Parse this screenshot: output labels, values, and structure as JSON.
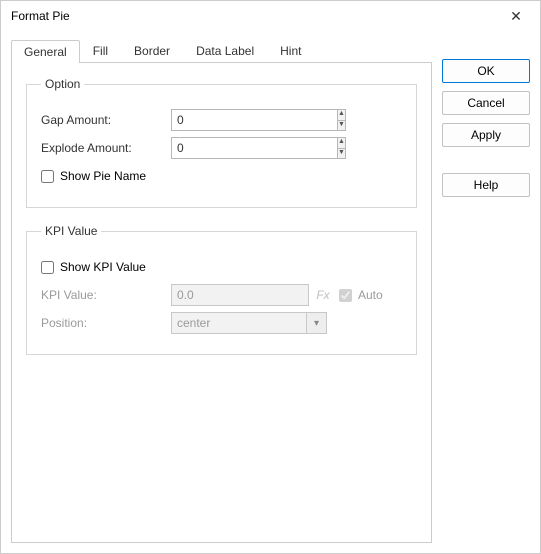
{
  "title": "Format Pie",
  "tabs": [
    "General",
    "Fill",
    "Border",
    "Data Label",
    "Hint"
  ],
  "activeTab": 0,
  "option": {
    "legend": "Option",
    "gapAmountLabel": "Gap Amount:",
    "gapAmountValue": "0",
    "explodeAmountLabel": "Explode Amount:",
    "explodeAmountValue": "0",
    "showPieNameLabel": "Show Pie Name",
    "showPieNameChecked": false
  },
  "kpi": {
    "legend": "KPI Value",
    "showKpiLabel": "Show KPI Value",
    "showKpiChecked": false,
    "kpiValueLabel": "KPI Value:",
    "kpiValue": "0.0",
    "fxLabel": "Fx",
    "autoLabel": "Auto",
    "autoChecked": true,
    "positionLabel": "Position:",
    "positionValue": "center"
  },
  "buttons": {
    "ok": "OK",
    "cancel": "Cancel",
    "apply": "Apply",
    "help": "Help"
  }
}
